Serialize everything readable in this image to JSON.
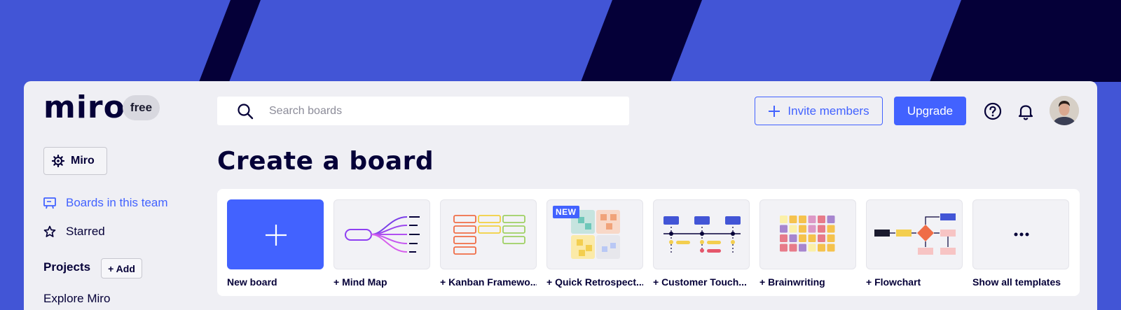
{
  "brand": {
    "logo_text": "miro",
    "plan_badge": "free"
  },
  "search": {
    "placeholder": "Search boards"
  },
  "header": {
    "invite_label": "Invite members",
    "upgrade_label": "Upgrade"
  },
  "sidebar": {
    "team_name": "Miro",
    "items": [
      {
        "label": "Boards in this team",
        "icon": "board-icon",
        "active": true
      },
      {
        "label": "Starred",
        "icon": "star-icon",
        "active": false
      }
    ],
    "projects_title": "Projects",
    "projects_add_label": "+ Add",
    "explore_label": "Explore Miro"
  },
  "main": {
    "title": "Create a board",
    "templates": [
      {
        "label": "New board",
        "thumb": "plus-icon"
      },
      {
        "label": "+ Mind Map",
        "thumb": "mind-map-thumbnail"
      },
      {
        "label": "+ Kanban Framewo...",
        "thumb": "kanban-thumbnail"
      },
      {
        "label": "+ Quick Retrospect...",
        "thumb": "retrospective-thumbnail",
        "badge": "NEW"
      },
      {
        "label": "+ Customer Touch...",
        "thumb": "customer-touchpoint-thumbnail"
      },
      {
        "label": "+ Brainwriting",
        "thumb": "brainwriting-thumbnail"
      },
      {
        "label": "+ Flowchart",
        "thumb": "flowchart-thumbnail"
      },
      {
        "label": "Show all templates",
        "thumb": "more-dots-icon"
      }
    ]
  },
  "colors": {
    "accent": "#4262ff",
    "background": "#4255d6",
    "stripe": "#050038",
    "panel": "#efeff4"
  }
}
